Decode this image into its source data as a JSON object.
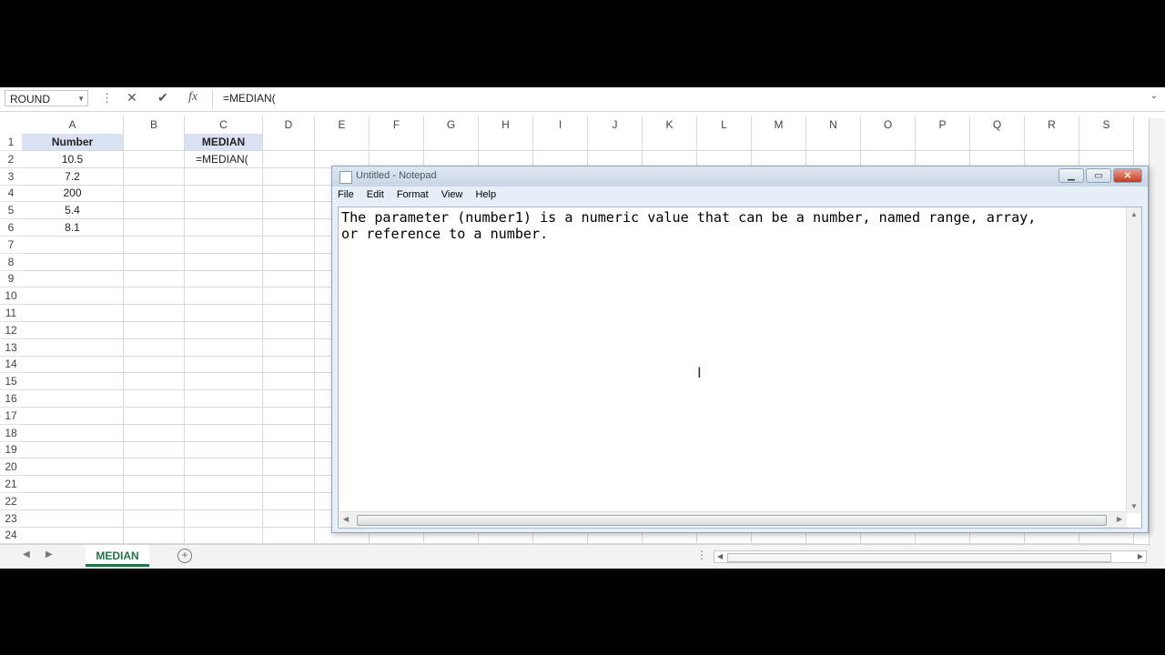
{
  "formula_bar": {
    "name_box": "ROUND",
    "formula": "=MEDIAN(",
    "cancel_icon": "✕",
    "enter_icon": "✔",
    "fx_label": "fx"
  },
  "columns": [
    "A",
    "B",
    "C",
    "D",
    "E",
    "F",
    "G",
    "H",
    "I",
    "J",
    "K",
    "L",
    "M",
    "N",
    "O",
    "P",
    "Q",
    "R",
    "S"
  ],
  "rows": [
    "1",
    "2",
    "3",
    "4",
    "5",
    "6",
    "7",
    "8",
    "9",
    "10",
    "11",
    "12",
    "13",
    "14",
    "15",
    "16",
    "17",
    "18",
    "19",
    "20",
    "21",
    "22",
    "23",
    "24"
  ],
  "cells": {
    "A1": "Number",
    "A2": "10.5",
    "A3": "7.2",
    "A4": "200",
    "A5": "5.4",
    "A6": "8.1",
    "C1": "MEDIAN",
    "C2": "=MEDIAN("
  },
  "sheet_tabs": [
    "MEDIAN"
  ],
  "notepad": {
    "title": "Untitled - Notepad",
    "menu": [
      "File",
      "Edit",
      "Format",
      "View",
      "Help"
    ],
    "text": "The parameter (number1) is a numeric value that can be a number, named range, array,\nor reference to a number."
  },
  "colors": {
    "header_fill": "#d9e1f2",
    "excel_green": "#217346"
  }
}
